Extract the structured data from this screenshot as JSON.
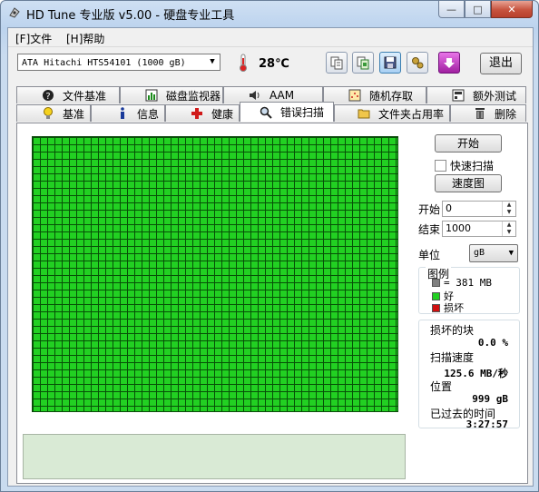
{
  "window": {
    "title": "HD Tune 专业版 v5.00 - 硬盘专业工具"
  },
  "caption": {
    "minimize": "—",
    "maximize": "□",
    "close": "✕"
  },
  "menu": {
    "file": "[F]文件",
    "help": "[H]帮助"
  },
  "toolbar": {
    "drive": "ATA    Hitachi HTS54101 (1000 gB)",
    "temperature": "28℃",
    "exit_label": "退出",
    "icons": [
      "copy-text-icon",
      "copy-screenshot-icon",
      "save-icon",
      "options-icon",
      "download-icon"
    ]
  },
  "tabs": {
    "row1": [
      "文件基准",
      "磁盘监视器",
      "AAM",
      "随机存取",
      "额外测试"
    ],
    "row2": [
      "基准",
      "信息",
      "健康",
      "错误扫描",
      "文件夹占用率",
      "删除"
    ],
    "active": "错误扫描"
  },
  "scan": {
    "start_button": "开始",
    "quick_scan_label": "快速扫描",
    "quick_scan_checked": false,
    "speed_map_button": "速度图",
    "start_label": "开始",
    "start_value": "0",
    "end_label": "结束",
    "end_value": "1000",
    "unit_label": "单位",
    "unit_value": "gB",
    "legend": {
      "title": "图例",
      "block_size": "= 381 MB",
      "good": "好",
      "damaged": "损坏",
      "colors": {
        "block": "#808080",
        "good": "#22d022",
        "damaged": "#d01010"
      }
    },
    "stats": {
      "damaged_blocks_label": "损坏的块",
      "damaged_blocks_value": "0.0 %",
      "scan_speed_label": "扫描速度",
      "scan_speed_value": "125.6 MB/秒",
      "position_label": "位置",
      "position_value": "999 gB",
      "elapsed_label": "已过去的时间",
      "elapsed_value": "3:27:57"
    }
  },
  "colors": {
    "grid_good": "#22d022",
    "log_box": "#d9ead5"
  }
}
